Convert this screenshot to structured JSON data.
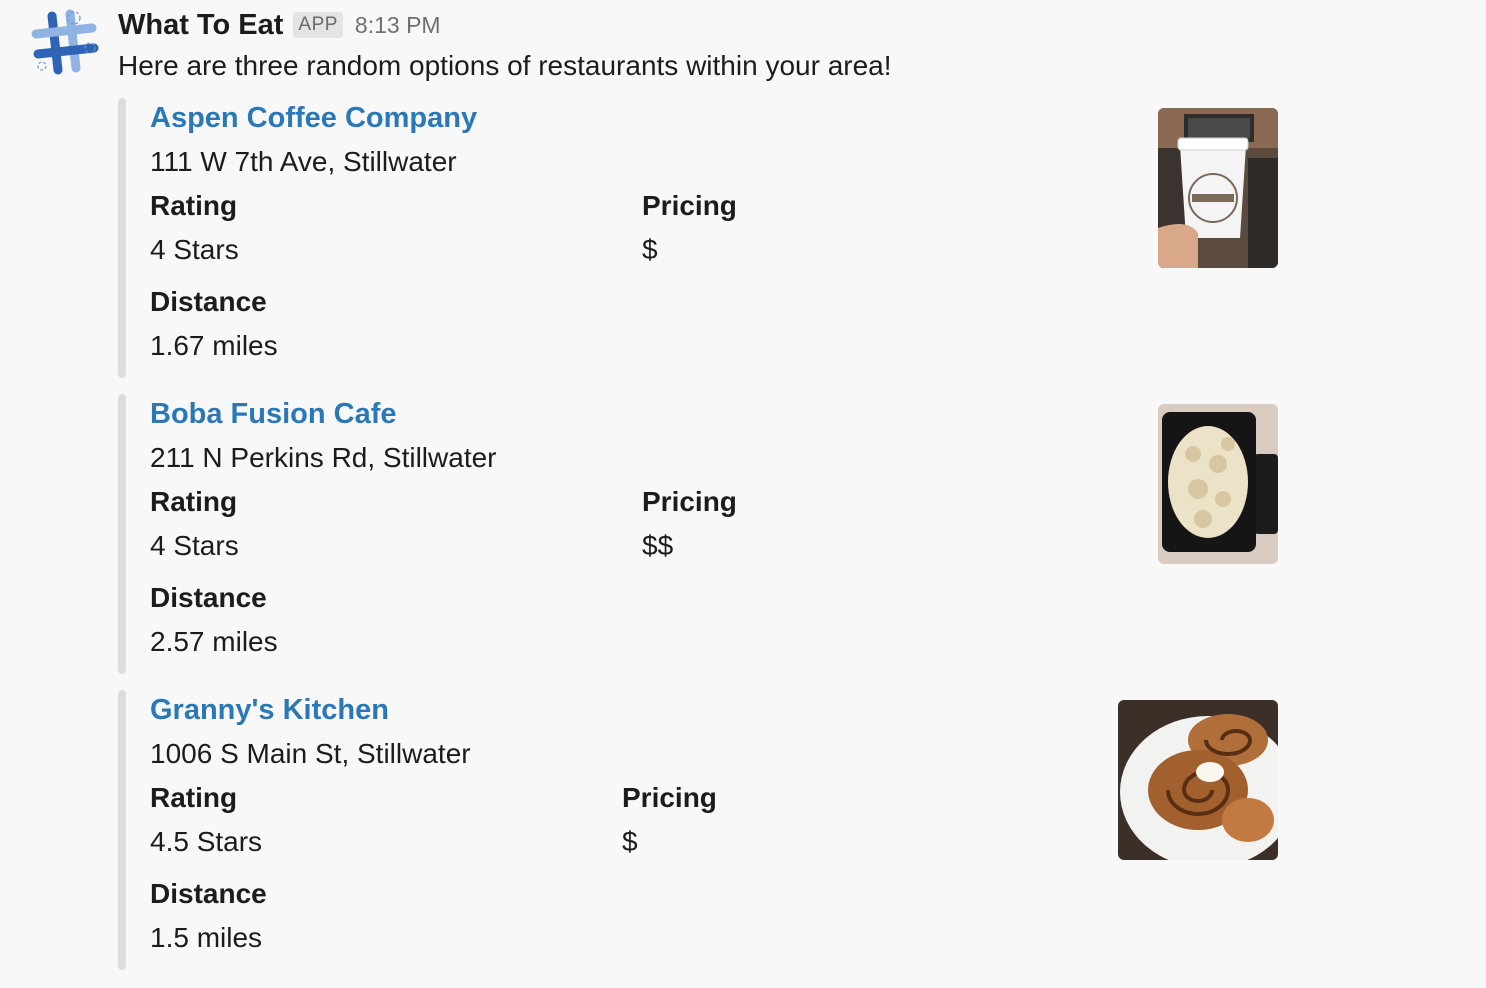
{
  "message": {
    "app_name": "What To Eat",
    "badge": "APP",
    "timestamp": "8:13 PM",
    "text": "Here are three random options of restaurants within your area!"
  },
  "labels": {
    "rating": "Rating",
    "pricing": "Pricing",
    "distance": "Distance"
  },
  "restaurants": [
    {
      "name": "Aspen Coffee Company",
      "address": "111 W 7th Ave, Stillwater",
      "rating": "4 Stars",
      "pricing": "$",
      "distance": "1.67 miles"
    },
    {
      "name": "Boba Fusion Cafe",
      "address": "211 N Perkins Rd, Stillwater",
      "rating": "4 Stars",
      "pricing": "$$",
      "distance": "2.57 miles"
    },
    {
      "name": "Granny's Kitchen",
      "address": "1006 S Main St, Stillwater",
      "rating": "4.5 Stars",
      "pricing": "$",
      "distance": "1.5 miles"
    }
  ],
  "colors": {
    "link": "#2a78b8",
    "background": "#f8f8f8",
    "attachment_bar": "#dddddd",
    "avatar_blue": "#3d6fbf"
  },
  "icons": {
    "avatar": "crosshatch-logo-icon"
  }
}
